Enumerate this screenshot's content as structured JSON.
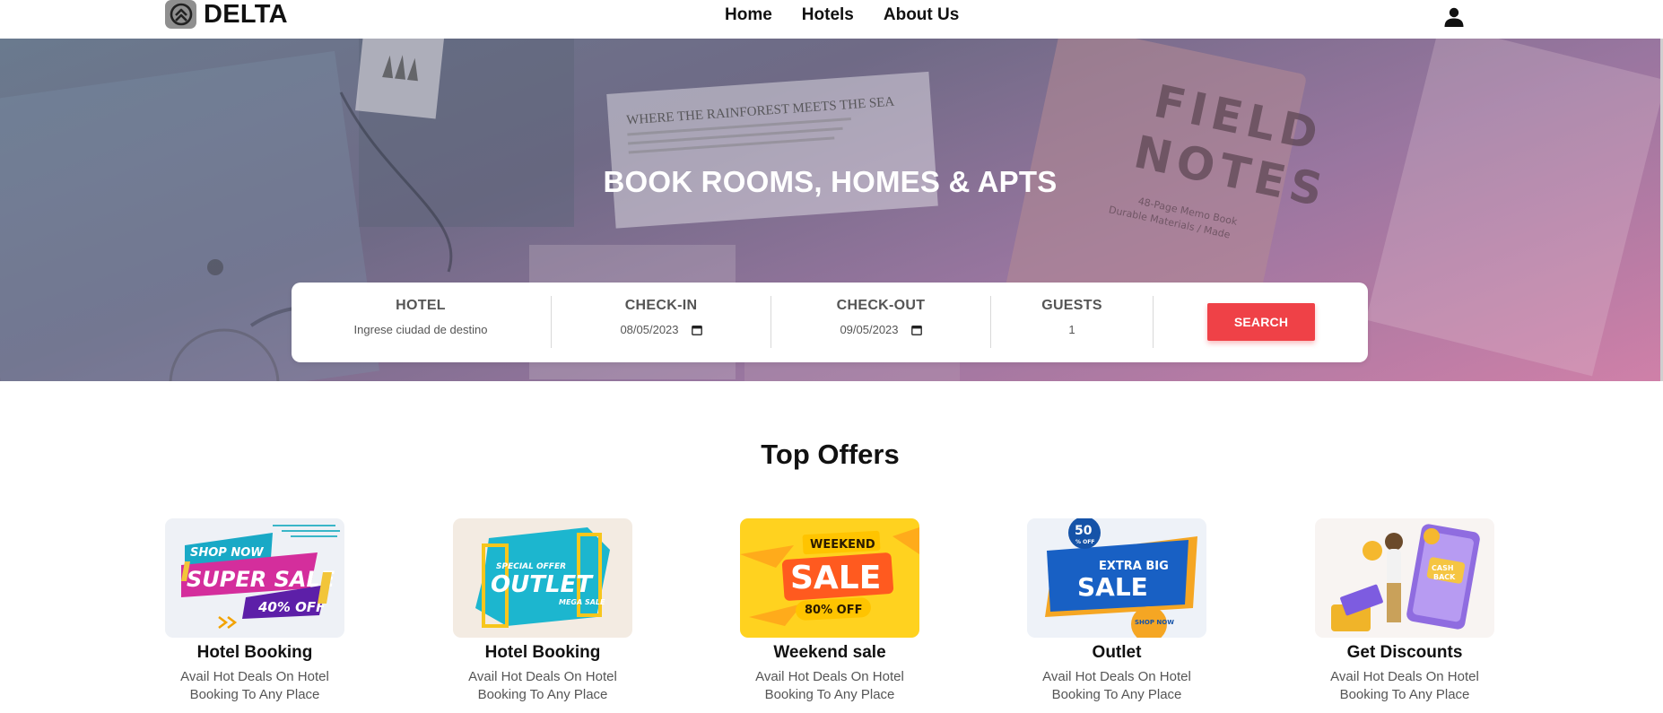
{
  "brand": {
    "name": "DELTA",
    "logo_icon": "delta-chevron-logo-icon"
  },
  "nav": {
    "links": [
      "Home",
      "Hotels",
      "About Us"
    ],
    "user_icon": "user-icon"
  },
  "hero": {
    "title": "BOOK ROOMS, HOMES & APTS",
    "background_texts": [
      "WHERE THE RAINFOREST MEETS THE SEA",
      "FIELD",
      "NOTES",
      "48-Page Memo Book",
      "Durable Materials / Made"
    ]
  },
  "search": {
    "hotel": {
      "label": "HOTEL",
      "placeholder": "Ingrese ciudad de destino"
    },
    "checkin": {
      "label": "CHECK-IN",
      "value": "08/05/2023",
      "icon": "calendar-icon"
    },
    "checkout": {
      "label": "CHECK-OUT",
      "value": "09/05/2023",
      "icon": "calendar-icon"
    },
    "guests": {
      "label": "GUESTS",
      "value": "1"
    },
    "button": "SEARCH"
  },
  "offers": {
    "title": "Top Offers",
    "cards": [
      {
        "title": "Hotel Booking",
        "desc": "Avail Hot Deals On Hotel Booking To Any Place",
        "image_texts": [
          "SHOP NOW",
          "SUPER SALE",
          "40% OFF"
        ]
      },
      {
        "title": "Hotel Booking",
        "desc": "Avail Hot Deals On Hotel Booking To Any Place",
        "image_texts": [
          "SPECIAL OFFER",
          "OUTLET",
          "MEGA SALE"
        ]
      },
      {
        "title": "Weekend sale",
        "desc": "Avail Hot Deals On Hotel Booking To Any Place",
        "image_texts": [
          "WEEKEND",
          "SALE",
          "80% OFF"
        ]
      },
      {
        "title": "Outlet",
        "desc": "Avail Hot Deals On Hotel Booking To Any Place",
        "image_texts": [
          "50",
          "% OFF",
          "EXTRA BIG",
          "SALE",
          "SHOP NOW"
        ]
      },
      {
        "title": "Get Discounts",
        "desc": "Avail Hot Deals On Hotel Booking To Any Place",
        "image_texts": [
          "CASH",
          "BACK"
        ]
      }
    ]
  },
  "colors": {
    "accent": "#ef4147",
    "text": "#111111",
    "muted": "#555555"
  }
}
